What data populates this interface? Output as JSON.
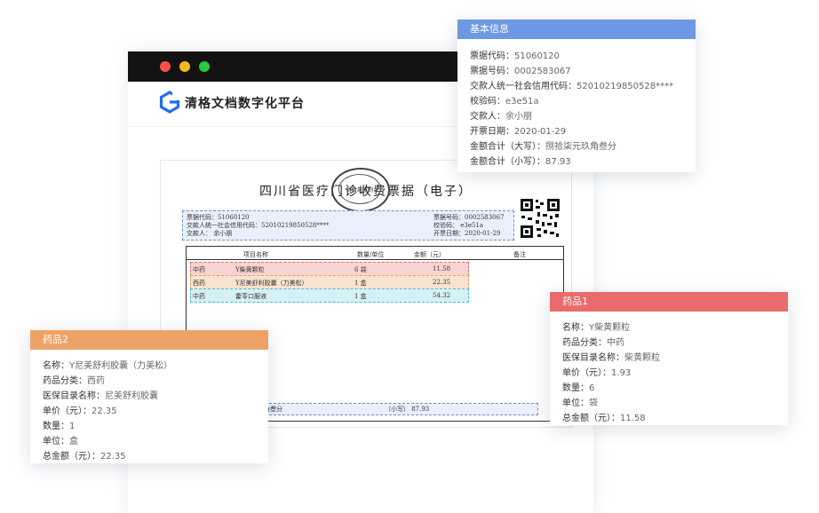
{
  "window": {
    "dots": [
      "#ff4d4d",
      "#f6b91b",
      "#27c93f"
    ]
  },
  "app": {
    "title": "清格文档数字化平台"
  },
  "receipt": {
    "title": "四川省医疗门诊收费票据（电子）",
    "seal_text": "财政部监制",
    "header": {
      "left": [
        "票据代码：51060120",
        "交款人统一社会信用代码：52010219850528****",
        "交款人：   余小朋"
      ],
      "right": [
        "票据号码：0002583067",
        "校验码：  e3e51a",
        "开票日期：2020-01-29"
      ]
    },
    "columns": [
      "项目名称",
      "数量/单位",
      "金额（元）",
      "备注"
    ],
    "rows": [
      {
        "category": "中药",
        "name": "Y柴黄颗粒",
        "qty": "6 袋",
        "amount": "11.58",
        "color": "#f8d3d3"
      },
      {
        "category": "西药",
        "name": "Y尼美舒利胶囊（力美松）",
        "qty": "1 盒",
        "amount": "22.35",
        "color": "#f9e3cf"
      },
      {
        "category": "中药",
        "name": "藿苓口服液",
        "qty": "1 盒",
        "amount": "54.32",
        "color": "#d6f1f6"
      }
    ],
    "total_words_fragment": "元玖角叁分",
    "total_small": "（小写） 87.93"
  },
  "basic_info": {
    "header": "基本信息",
    "color": "#6d98e3",
    "items": [
      {
        "label": "票据代码：",
        "value": "51060120"
      },
      {
        "label": "票据号码：",
        "value": "0002583067"
      },
      {
        "label": "交款人统一社会信用代码：",
        "value": "52010219850528****"
      },
      {
        "label": "校验码：",
        "value": "e3e51a"
      },
      {
        "label": "交款人：",
        "value": "余小朋"
      },
      {
        "label": "开票日期：",
        "value": "2020-01-29"
      },
      {
        "label": "金额合计（大写）：",
        "value": "捌拾柒元玖角叁分"
      },
      {
        "label": "金额合计（小写）：",
        "value": "87.93"
      }
    ]
  },
  "drug1": {
    "header": "药品1",
    "color": "#ea6b6b",
    "items": [
      {
        "label": "名称：",
        "value": "Y柴黄颗粒"
      },
      {
        "label": "药品分类：",
        "value": "中药"
      },
      {
        "label": "医保目录名称：",
        "value": "柴黄颗粒"
      },
      {
        "label": "单价（元）：",
        "value": "1.93"
      },
      {
        "label": "数量：",
        "value": "6"
      },
      {
        "label": "单位：",
        "value": "袋"
      },
      {
        "label": "总金额（元）：",
        "value": "11.58"
      }
    ]
  },
  "drug2": {
    "header": "药品2",
    "color": "#eda367",
    "items": [
      {
        "label": "名称：",
        "value": "Y尼美舒利胶囊（力美松）"
      },
      {
        "label": "药品分类：",
        "value": "西药"
      },
      {
        "label": "医保目录名称：",
        "value": "尼美舒利胶囊"
      },
      {
        "label": "单价（元）：",
        "value": "22.35"
      },
      {
        "label": "数量：",
        "value": "1"
      },
      {
        "label": "单位：",
        "value": "盒"
      },
      {
        "label": "总金额（元）：",
        "value": "22.35"
      }
    ]
  }
}
